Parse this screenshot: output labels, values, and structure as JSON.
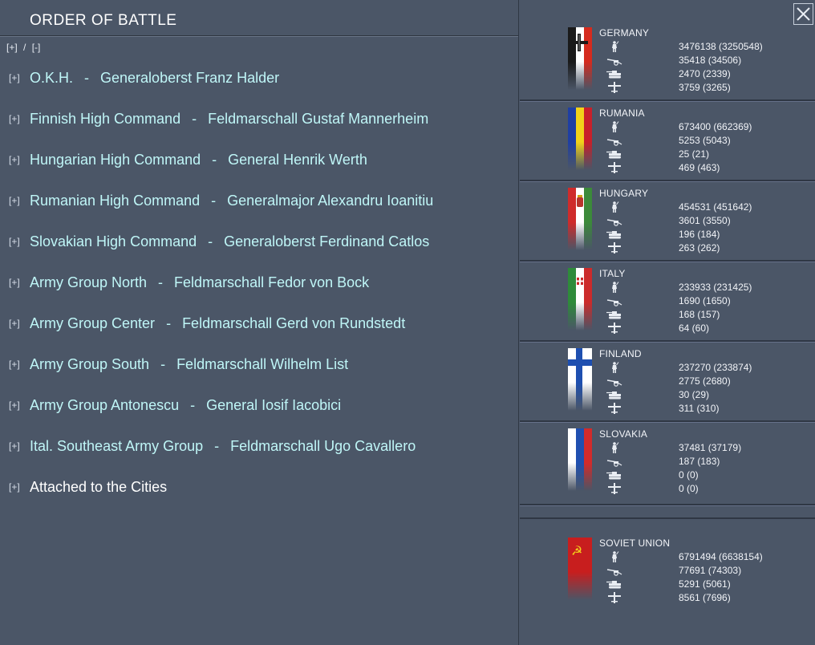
{
  "window": {
    "title": "ORDER OF BATTLE",
    "expand_all": "[+]",
    "collapse_all": "[-]",
    "expand_sep": "/"
  },
  "close_icon": "close-x-icon",
  "commands": [
    {
      "toggle": "[+]",
      "name": "O.K.H.",
      "sep": "-",
      "commander": "Generaloberst Franz Halder"
    },
    {
      "toggle": "[+]",
      "name": "Finnish High Command",
      "sep": "-",
      "commander": "Feldmarschall Gustaf Mannerheim"
    },
    {
      "toggle": "[+]",
      "name": "Hungarian High Command",
      "sep": "-",
      "commander": "General Henrik Werth"
    },
    {
      "toggle": "[+]",
      "name": "Rumanian High Command",
      "sep": "-",
      "commander": "Generalmajor Alexandru Ioanitiu"
    },
    {
      "toggle": "[+]",
      "name": "Slovakian High Command",
      "sep": "-",
      "commander": "Generaloberst Ferdinand Catlos"
    },
    {
      "toggle": "[+]",
      "name": "Army Group North",
      "sep": "-",
      "commander": "Feldmarschall Fedor von Bock"
    },
    {
      "toggle": "[+]",
      "name": "Army Group Center",
      "sep": "-",
      "commander": "Feldmarschall Gerd von Rundstedt"
    },
    {
      "toggle": "[+]",
      "name": "Army Group South",
      "sep": "-",
      "commander": "Feldmarschall Wilhelm List"
    },
    {
      "toggle": "[+]",
      "name": "Army Group Antonescu",
      "sep": "-",
      "commander": "General Iosif Iacobici"
    },
    {
      "toggle": "[+]",
      "name": "Ital. Southeast Army Group",
      "sep": "-",
      "commander": "Feldmarschall Ugo Cavallero"
    },
    {
      "toggle": "[+]",
      "name": "Attached to the Cities",
      "sep": "",
      "commander": ""
    }
  ],
  "stat_icons": [
    "infantry-icon",
    "artillery-icon",
    "tank-icon",
    "aircraft-icon"
  ],
  "nations": [
    {
      "name": "GERMANY",
      "flag": "germany-flag",
      "colors": [
        "#1a1a1a",
        "#ffffff",
        "#d52b1e"
      ],
      "stats": [
        "3476138 (3250548)",
        "35418 (34506)",
        "2470 (2339)",
        "3759 (3265)"
      ]
    },
    {
      "name": "RUMANIA",
      "flag": "rumania-flag",
      "colors": [
        "#1f3fa3",
        "#f2d21a",
        "#c8202a"
      ],
      "stats": [
        "673400 (662369)",
        "5253 (5043)",
        "25 (21)",
        "469 (463)"
      ]
    },
    {
      "name": "HUNGARY",
      "flag": "hungary-flag",
      "colors": [
        "#cf2b2b",
        "#ffffff",
        "#3c8a3a"
      ],
      "stats": [
        "454531 (451642)",
        "3601 (3550)",
        "196 (184)",
        "263 (262)"
      ]
    },
    {
      "name": "ITALY",
      "flag": "italy-flag",
      "colors": [
        "#2e8b3a",
        "#ffffff",
        "#cc2b2b"
      ],
      "stats": [
        "233933 (231425)",
        "1690 (1650)",
        "168 (157)",
        "64 (60)"
      ]
    },
    {
      "name": "FINLAND",
      "flag": "finland-flag",
      "colors": [
        "#ffffff",
        "#1e4fb0"
      ],
      "stats": [
        "237270 (233874)",
        "2775 (2680)",
        "30 (29)",
        "311 (310)"
      ]
    },
    {
      "name": "SLOVAKIA",
      "flag": "slovakia-flag",
      "colors": [
        "#ffffff",
        "#1f4fb0",
        "#d22b2b"
      ],
      "stats": [
        "37481 (37179)",
        "187 (183)",
        "0 (0)",
        "0 (0)"
      ]
    },
    {
      "name": "SOVIET UNION",
      "flag": "soviet-flag",
      "colors": [
        "#c81e1e",
        "#f3d21a"
      ],
      "stats": [
        "6791494 (6638154)",
        "77691 (74303)",
        "5291 (5061)",
        "8561 (7696)"
      ]
    }
  ]
}
